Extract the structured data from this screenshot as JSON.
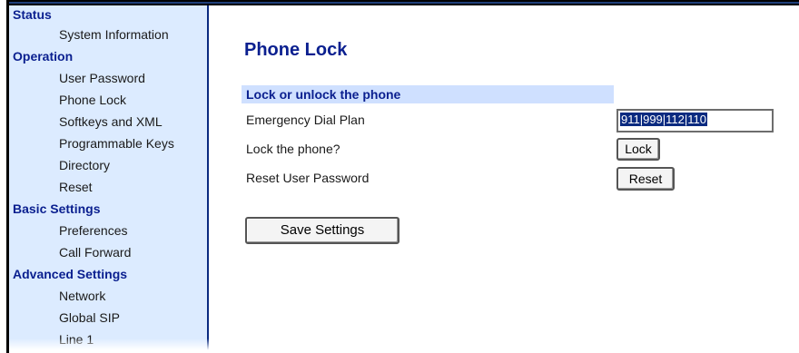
{
  "sidebar": {
    "groups": [
      {
        "title": "Status",
        "items": [
          "System Information"
        ]
      },
      {
        "title": "Operation",
        "items": [
          "User Password",
          "Phone Lock",
          "Softkeys and XML",
          "Programmable Keys",
          "Directory",
          "Reset"
        ]
      },
      {
        "title": "Basic Settings",
        "items": [
          "Preferences",
          "Call Forward"
        ]
      },
      {
        "title": "Advanced Settings",
        "items": [
          "Network",
          "Global SIP",
          "Line 1"
        ]
      }
    ]
  },
  "main": {
    "page_title": "Phone Lock",
    "section_header": "Lock or unlock the phone",
    "rows": {
      "emergency_label": "Emergency Dial Plan",
      "emergency_value": "911|999|112|110",
      "lock_label": "Lock the phone?",
      "lock_button": "Lock",
      "reset_label": "Reset User Password",
      "reset_button": "Reset"
    },
    "save_button": "Save Settings"
  },
  "colors": {
    "sidebar_bg": "#dcebff",
    "heading_blue": "#0a1f8f",
    "section_bg": "#cfe0ff",
    "selection": "#0a2a80"
  }
}
